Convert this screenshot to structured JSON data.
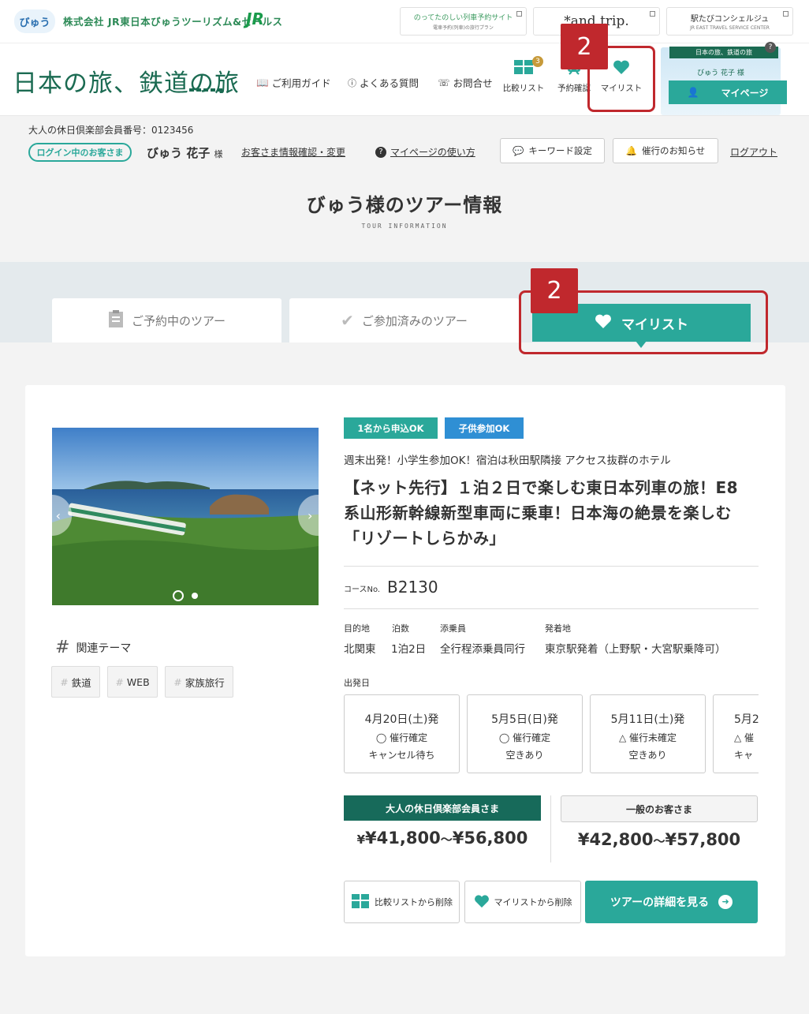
{
  "topbar": {
    "brand_short": "びゅう",
    "company": "株式会社 JR東日本びゅうツーリズム&セールス",
    "jr_mark": "JR",
    "ext_links": [
      {
        "label": "のってたのしい列車予約サイト",
        "sub": "電車予約(列車)の旅行プラン"
      },
      {
        "label": "*and trip.",
        "sub": ""
      },
      {
        "label": "駅たびコンシェルジュ",
        "sub": "JR EAST TRAVEL SERVICE CENTER"
      }
    ]
  },
  "header": {
    "logo_text": "日本の旅、鉄道の旅",
    "nav": [
      {
        "label": "ご利用ガイド"
      },
      {
        "label": "よくある質問"
      },
      {
        "label": "お問合せ"
      }
    ],
    "icons": {
      "compare_label": "比較リスト",
      "compare_count": "3",
      "reserve_label": "予約確認",
      "mylist_label": "マイリスト"
    },
    "mypage": {
      "tag": "日本の旅、鉄道の旅",
      "name": "びゅう 花子 様",
      "button": "マイページ",
      "help": "?"
    }
  },
  "annotation": {
    "callout_1": "2",
    "callout_2": "2"
  },
  "member": {
    "number_text": "大人の休日倶楽部会員番号：0123456",
    "login_badge": "ログイン中のお客さま",
    "user_name": "びゅう 花子",
    "honorific": "様",
    "info_link": "お客さま情報確認・変更",
    "guide_link": "マイページの使い方",
    "keyword_btn": "キーワード設定",
    "notice_btn": "催行のお知らせ",
    "logout": "ログアウト"
  },
  "page": {
    "title": "びゅう様のツアー情報",
    "subtitle": "TOUR INFORMATION"
  },
  "tabs": [
    {
      "label": "ご予約中のツアー"
    },
    {
      "label": "ご参加済みのツアー"
    },
    {
      "label": "マイリスト"
    }
  ],
  "tour": {
    "labels": [
      {
        "text": "1名から申込OK",
        "color": "#2aa89a"
      },
      {
        "text": "子供参加OK",
        "color": "#2f8fd4"
      }
    ],
    "catch": "週末出発！小学生参加OK！宿泊は秋田駅隣接 アクセス抜群のホテル",
    "title_lines": [
      "【ネット先行】１泊２日で楽しむ東日本列車の旅！E8",
      "系山形新幹線新型車両に乗車！日本海の絶景を楽しむ",
      "「リゾートしらかみ」"
    ],
    "course_label": "コースNo.",
    "course_no": "B2130",
    "info": [
      {
        "label": "目的地",
        "value": "北関東"
      },
      {
        "label": "泊数",
        "value": "1泊2日"
      },
      {
        "label": "添乗員",
        "value": "全行程添乗員同行"
      },
      {
        "label": "発着地",
        "value": "東京駅発着（上野駅・大宮駅乗降可）"
      }
    ],
    "departure_label": "出発日",
    "dates": [
      {
        "date": "4月20日(土)発",
        "status": "◯ 催行確定",
        "seats": "キャンセル待ち"
      },
      {
        "date": "5月5日(日)発",
        "status": "◯ 催行確定",
        "seats": "空きあり"
      },
      {
        "date": "5月11日(土)発",
        "status": "△ 催行未確定",
        "seats": "空きあり"
      },
      {
        "date": "5月2",
        "status": "△ 催",
        "seats": "キャ"
      }
    ],
    "price_member_label": "大人の休日倶楽部会員さま",
    "price_member": {
      "min": "¥41,800",
      "sep": "～",
      "max": "¥56,800"
    },
    "price_general_label": "一般のお客さま",
    "price_general": {
      "min": "¥42,800",
      "sep": "～",
      "max": "¥57,800"
    },
    "actions": {
      "remove_compare": "比較リストから削除",
      "remove_mylist": "マイリストから削除",
      "detail": "ツアーの詳細を見る"
    },
    "theme_title": "関連テーマ",
    "themes": [
      "鉄道",
      "WEB",
      "家族旅行"
    ]
  }
}
